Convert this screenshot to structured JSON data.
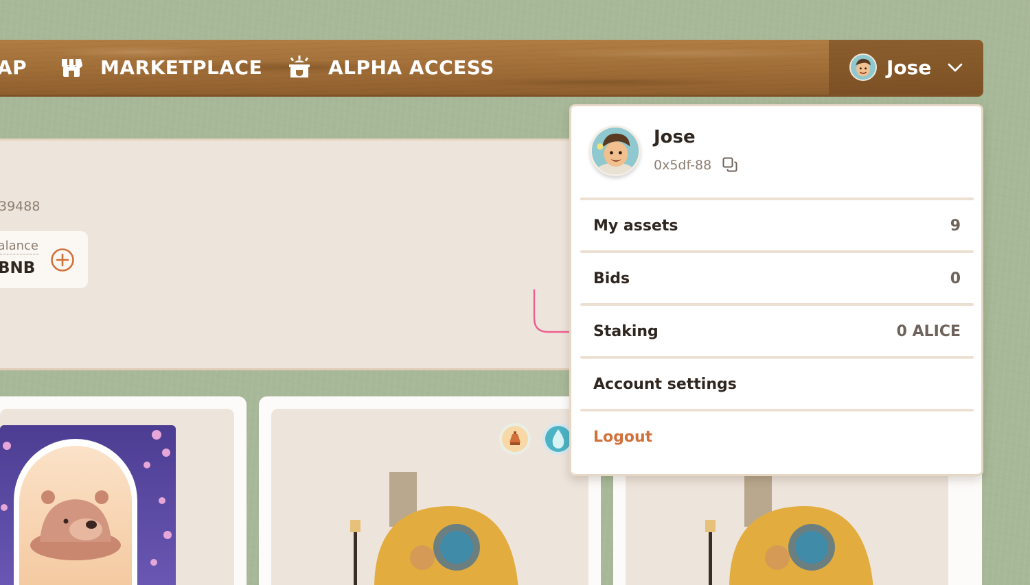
{
  "nav": {
    "items": [
      {
        "label": "AP",
        "icon": "map-icon"
      },
      {
        "label": "MARKETPLACE",
        "icon": "marketplace-icon"
      },
      {
        "label": "ALPHA ACCESS",
        "icon": "alpha-access-icon"
      }
    ],
    "user_name": "Jose"
  },
  "profile": {
    "address_snippet": "39488",
    "balance_label": "alance",
    "balance_value": "BNB"
  },
  "dropdown": {
    "name": "Jose",
    "address": "0x5df-88",
    "rows": [
      {
        "label": "My assets",
        "value": "9"
      },
      {
        "label": "Bids",
        "value": "0"
      },
      {
        "label": "Staking",
        "value": "0 ALICE"
      },
      {
        "label": "Account settings",
        "value": ""
      },
      {
        "label": "Logout",
        "value": ""
      }
    ]
  },
  "colors": {
    "nav_wood": "#a06d37",
    "background_green": "#a7b898",
    "panel": "#ede4db",
    "logout_orange": "#d2703a",
    "arrow_pink": "#ee5f8e"
  }
}
